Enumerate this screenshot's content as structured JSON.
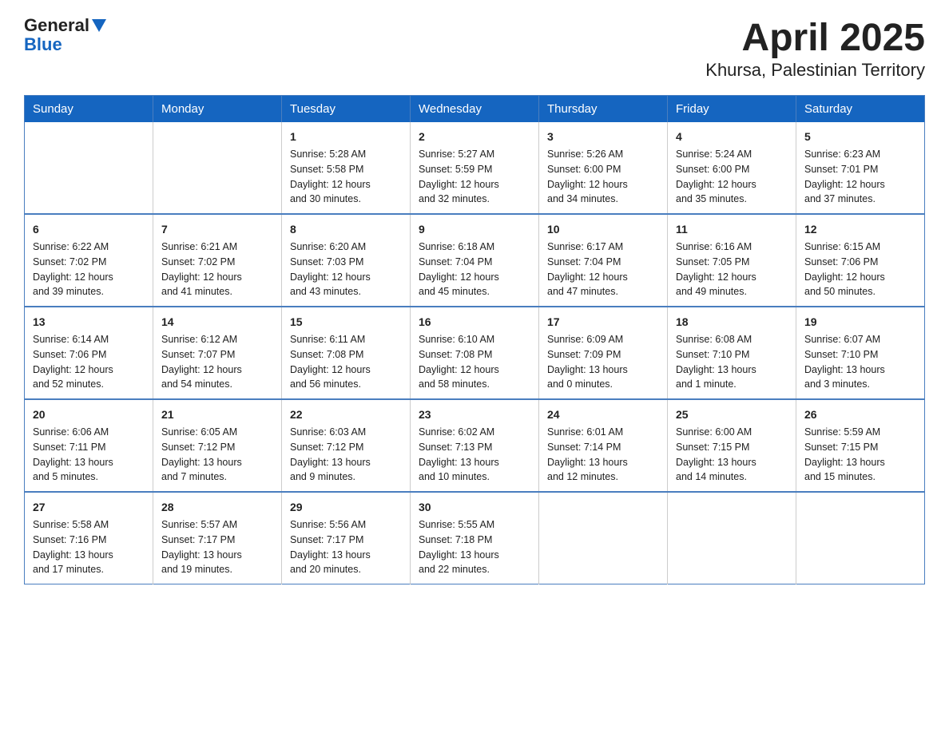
{
  "header": {
    "logo_general": "General",
    "logo_blue": "Blue",
    "title": "April 2025",
    "subtitle": "Khursa, Palestinian Territory"
  },
  "days_of_week": [
    "Sunday",
    "Monday",
    "Tuesday",
    "Wednesday",
    "Thursday",
    "Friday",
    "Saturday"
  ],
  "weeks": [
    [
      {
        "day": "",
        "info": ""
      },
      {
        "day": "",
        "info": ""
      },
      {
        "day": "1",
        "info": "Sunrise: 5:28 AM\nSunset: 5:58 PM\nDaylight: 12 hours\nand 30 minutes."
      },
      {
        "day": "2",
        "info": "Sunrise: 5:27 AM\nSunset: 5:59 PM\nDaylight: 12 hours\nand 32 minutes."
      },
      {
        "day": "3",
        "info": "Sunrise: 5:26 AM\nSunset: 6:00 PM\nDaylight: 12 hours\nand 34 minutes."
      },
      {
        "day": "4",
        "info": "Sunrise: 5:24 AM\nSunset: 6:00 PM\nDaylight: 12 hours\nand 35 minutes."
      },
      {
        "day": "5",
        "info": "Sunrise: 6:23 AM\nSunset: 7:01 PM\nDaylight: 12 hours\nand 37 minutes."
      }
    ],
    [
      {
        "day": "6",
        "info": "Sunrise: 6:22 AM\nSunset: 7:02 PM\nDaylight: 12 hours\nand 39 minutes."
      },
      {
        "day": "7",
        "info": "Sunrise: 6:21 AM\nSunset: 7:02 PM\nDaylight: 12 hours\nand 41 minutes."
      },
      {
        "day": "8",
        "info": "Sunrise: 6:20 AM\nSunset: 7:03 PM\nDaylight: 12 hours\nand 43 minutes."
      },
      {
        "day": "9",
        "info": "Sunrise: 6:18 AM\nSunset: 7:04 PM\nDaylight: 12 hours\nand 45 minutes."
      },
      {
        "day": "10",
        "info": "Sunrise: 6:17 AM\nSunset: 7:04 PM\nDaylight: 12 hours\nand 47 minutes."
      },
      {
        "day": "11",
        "info": "Sunrise: 6:16 AM\nSunset: 7:05 PM\nDaylight: 12 hours\nand 49 minutes."
      },
      {
        "day": "12",
        "info": "Sunrise: 6:15 AM\nSunset: 7:06 PM\nDaylight: 12 hours\nand 50 minutes."
      }
    ],
    [
      {
        "day": "13",
        "info": "Sunrise: 6:14 AM\nSunset: 7:06 PM\nDaylight: 12 hours\nand 52 minutes."
      },
      {
        "day": "14",
        "info": "Sunrise: 6:12 AM\nSunset: 7:07 PM\nDaylight: 12 hours\nand 54 minutes."
      },
      {
        "day": "15",
        "info": "Sunrise: 6:11 AM\nSunset: 7:08 PM\nDaylight: 12 hours\nand 56 minutes."
      },
      {
        "day": "16",
        "info": "Sunrise: 6:10 AM\nSunset: 7:08 PM\nDaylight: 12 hours\nand 58 minutes."
      },
      {
        "day": "17",
        "info": "Sunrise: 6:09 AM\nSunset: 7:09 PM\nDaylight: 13 hours\nand 0 minutes."
      },
      {
        "day": "18",
        "info": "Sunrise: 6:08 AM\nSunset: 7:10 PM\nDaylight: 13 hours\nand 1 minute."
      },
      {
        "day": "19",
        "info": "Sunrise: 6:07 AM\nSunset: 7:10 PM\nDaylight: 13 hours\nand 3 minutes."
      }
    ],
    [
      {
        "day": "20",
        "info": "Sunrise: 6:06 AM\nSunset: 7:11 PM\nDaylight: 13 hours\nand 5 minutes."
      },
      {
        "day": "21",
        "info": "Sunrise: 6:05 AM\nSunset: 7:12 PM\nDaylight: 13 hours\nand 7 minutes."
      },
      {
        "day": "22",
        "info": "Sunrise: 6:03 AM\nSunset: 7:12 PM\nDaylight: 13 hours\nand 9 minutes."
      },
      {
        "day": "23",
        "info": "Sunrise: 6:02 AM\nSunset: 7:13 PM\nDaylight: 13 hours\nand 10 minutes."
      },
      {
        "day": "24",
        "info": "Sunrise: 6:01 AM\nSunset: 7:14 PM\nDaylight: 13 hours\nand 12 minutes."
      },
      {
        "day": "25",
        "info": "Sunrise: 6:00 AM\nSunset: 7:15 PM\nDaylight: 13 hours\nand 14 minutes."
      },
      {
        "day": "26",
        "info": "Sunrise: 5:59 AM\nSunset: 7:15 PM\nDaylight: 13 hours\nand 15 minutes."
      }
    ],
    [
      {
        "day": "27",
        "info": "Sunrise: 5:58 AM\nSunset: 7:16 PM\nDaylight: 13 hours\nand 17 minutes."
      },
      {
        "day": "28",
        "info": "Sunrise: 5:57 AM\nSunset: 7:17 PM\nDaylight: 13 hours\nand 19 minutes."
      },
      {
        "day": "29",
        "info": "Sunrise: 5:56 AM\nSunset: 7:17 PM\nDaylight: 13 hours\nand 20 minutes."
      },
      {
        "day": "30",
        "info": "Sunrise: 5:55 AM\nSunset: 7:18 PM\nDaylight: 13 hours\nand 22 minutes."
      },
      {
        "day": "",
        "info": ""
      },
      {
        "day": "",
        "info": ""
      },
      {
        "day": "",
        "info": ""
      }
    ]
  ]
}
